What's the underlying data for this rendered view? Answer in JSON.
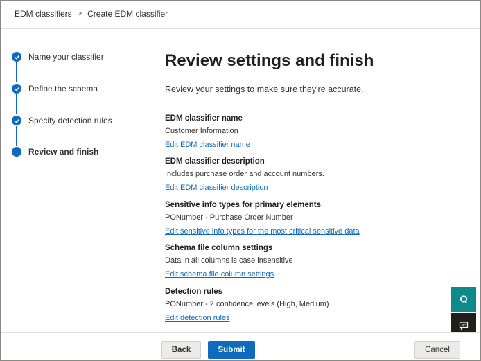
{
  "breadcrumb": {
    "items": [
      "EDM classifiers",
      "Create EDM classifier"
    ],
    "separator": ">"
  },
  "steps": [
    {
      "label": "Name your classifier",
      "state": "completed"
    },
    {
      "label": "Define the schema",
      "state": "completed"
    },
    {
      "label": "Specify detection rules",
      "state": "completed"
    },
    {
      "label": "Review and finish",
      "state": "current"
    }
  ],
  "main": {
    "title": "Review settings and finish",
    "intro": "Review your settings to make sure they're accurate.",
    "sections": [
      {
        "heading": "EDM classifier name",
        "value": "Customer Information",
        "link": "Edit EDM classifier name"
      },
      {
        "heading": "EDM classifier description",
        "value": "Includes purchase order and account numbers.",
        "link": "Edit EDM classifier description"
      },
      {
        "heading": "Sensitive info types for primary elements",
        "value": "PONumber - Purchase Order Number",
        "link": "Edit sensitive info types for the most critical sensitive data"
      },
      {
        "heading": "Schema file column settings",
        "value": "Data in all columns is case insensitive",
        "link": "Edit schema file column settings"
      },
      {
        "heading": "Detection rules",
        "value": "PONumber - 2 confidence levels (High, Medium)",
        "link": "Edit detection rules"
      }
    ]
  },
  "footer": {
    "back_label": "Back",
    "submit_label": "Submit",
    "cancel_label": "Cancel"
  },
  "side_buttons": {
    "assist_icon": "assistant-icon",
    "feedback_icon": "feedback-icon"
  },
  "colors": {
    "accent": "#0f6cbd",
    "assist": "#0f8a8a",
    "feedback": "#201f1e"
  }
}
